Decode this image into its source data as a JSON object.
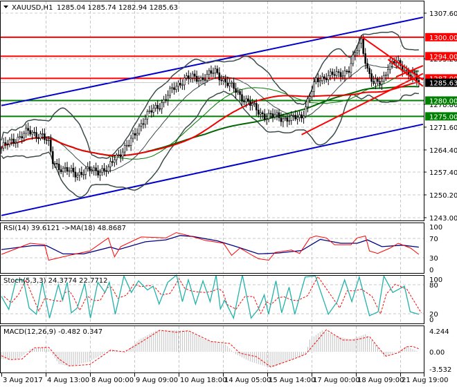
{
  "header": {
    "symbol": "XAUUSD,H1",
    "ohlc": "1285.04 1285.74 1282.94 1285.63"
  },
  "colors": {
    "level_red": "#ff0000",
    "level_green": "#008000",
    "channel": "#0000cc",
    "bands": "#3a4a4a",
    "ma_fast": "#007700",
    "ma_slow": "#ee0000",
    "ma_long": "#006400",
    "rsi": "#ff0000",
    "rsi_ma": "#000080",
    "stoch_main": "#20b2aa",
    "stoch_signal": "#ff0000",
    "macd_hist": "#c0c0c0",
    "macd_signal": "#ff0000"
  },
  "price_axis": {
    "ticks": [
      "1307.60",
      "1293.20",
      "1278.80",
      "1271.60",
      "1264.40",
      "1257.40",
      "1250.20",
      "1243.00"
    ],
    "levels": [
      {
        "value": 1300.0,
        "label": "1300.00",
        "color": "#ff0000"
      },
      {
        "value": 1294.0,
        "label": "1294.00",
        "color": "#ff0000"
      },
      {
        "value": 1287.0,
        "label": "1287.00",
        "color": "#ff0000"
      },
      {
        "value": 1280.0,
        "label": "1280.00",
        "color": "#008000"
      },
      {
        "value": 1275.0,
        "label": "1275.00",
        "color": "#008000"
      }
    ],
    "current": {
      "value": 1285.63,
      "label": "1285.63"
    }
  },
  "chart_data": {
    "type": "line",
    "title": "XAUUSD,H1",
    "price_path": [
      [
        0,
        1265
      ],
      [
        7,
        1268
      ],
      [
        13,
        1270
      ],
      [
        20,
        1269
      ],
      [
        23,
        1266
      ],
      [
        25,
        1261
      ],
      [
        30,
        1258
      ],
      [
        37,
        1257
      ],
      [
        44,
        1258
      ],
      [
        52,
        1258
      ],
      [
        55,
        1262
      ],
      [
        62,
        1266
      ],
      [
        67,
        1272
      ],
      [
        72,
        1276
      ],
      [
        79,
        1280
      ],
      [
        84,
        1284
      ],
      [
        89,
        1287
      ],
      [
        97,
        1287
      ],
      [
        104,
        1289
      ],
      [
        109,
        1286
      ],
      [
        114,
        1283
      ],
      [
        119,
        1280
      ],
      [
        124,
        1277
      ],
      [
        129,
        1275
      ],
      [
        134,
        1275
      ],
      [
        141,
        1274
      ],
      [
        146,
        1275
      ],
      [
        149,
        1280
      ],
      [
        153,
        1286
      ],
      [
        158,
        1288
      ],
      [
        164,
        1288
      ],
      [
        169,
        1290
      ],
      [
        173,
        1296
      ],
      [
        175,
        1299
      ],
      [
        178,
        1290
      ],
      [
        181,
        1285
      ],
      [
        185,
        1286
      ],
      [
        188,
        1291
      ],
      [
        191,
        1292
      ],
      [
        196,
        1290
      ],
      [
        200,
        1288
      ],
      [
        203,
        1285.6
      ]
    ],
    "channel_upper": [
      [
        0,
        1278.4
      ],
      [
        205,
        1306.3
      ]
    ],
    "channel_lower": [
      [
        0,
        1243.7
      ],
      [
        205,
        1272.5
      ]
    ],
    "trend_lines": [
      [
        [
          175,
          1300.2
        ],
        [
          205,
          1286.5
        ]
      ],
      [
        [
          146,
          1269.2
        ],
        [
          205,
          1288.5
        ]
      ],
      [
        [
          188,
          1293
        ],
        [
          205,
          1284.5
        ]
      ],
      [
        [
          192,
          1287.5
        ],
        [
          205,
          1291
        ]
      ]
    ],
    "time_labels": [
      "3 Aug 2017",
      "4 Aug 13:00",
      "8 Aug 00:00",
      "9 Aug 09:00",
      "10 Aug 18:00",
      "14 Aug 05:00",
      "15 Aug 14:00",
      "17 Aug 00:00",
      "18 Aug 09:00",
      "21 Aug 19:00"
    ],
    "ylim": [
      1243.0,
      1307.6
    ]
  },
  "rsi": {
    "label": "RSI(14) 39.6121  ->MA(18) 48.8687",
    "ticks": [
      "100",
      "70",
      "30",
      "0"
    ],
    "values": [
      [
        0,
        37
      ],
      [
        14,
        60
      ],
      [
        21,
        57
      ],
      [
        23,
        25
      ],
      [
        33,
        35
      ],
      [
        43,
        44
      ],
      [
        52,
        71
      ],
      [
        55,
        32
      ],
      [
        58,
        53
      ],
      [
        68,
        73
      ],
      [
        80,
        71
      ],
      [
        85,
        82
      ],
      [
        91,
        76
      ],
      [
        99,
        66
      ],
      [
        108,
        60
      ],
      [
        112,
        35
      ],
      [
        116,
        50
      ],
      [
        122,
        35
      ],
      [
        125,
        28
      ],
      [
        130,
        25
      ],
      [
        133,
        41
      ],
      [
        141,
        46
      ],
      [
        145,
        39
      ],
      [
        150,
        71
      ],
      [
        153,
        75
      ],
      [
        158,
        71
      ],
      [
        162,
        57
      ],
      [
        170,
        57
      ],
      [
        173,
        71
      ],
      [
        177,
        75
      ],
      [
        179,
        44
      ],
      [
        183,
        39
      ],
      [
        189,
        50
      ],
      [
        193,
        60
      ],
      [
        199,
        50
      ],
      [
        203,
        37
      ]
    ],
    "ma": [
      [
        0,
        47
      ],
      [
        15,
        55
      ],
      [
        22,
        55
      ],
      [
        30,
        38
      ],
      [
        40,
        38
      ],
      [
        53,
        52
      ],
      [
        57,
        47
      ],
      [
        70,
        63
      ],
      [
        80,
        67
      ],
      [
        87,
        76
      ],
      [
        93,
        74
      ],
      [
        105,
        65
      ],
      [
        115,
        52
      ],
      [
        125,
        38
      ],
      [
        135,
        40
      ],
      [
        146,
        45
      ],
      [
        155,
        68
      ],
      [
        165,
        60
      ],
      [
        173,
        60
      ],
      [
        178,
        67
      ],
      [
        185,
        53
      ],
      [
        195,
        56
      ],
      [
        203,
        52
      ]
    ]
  },
  "stoch": {
    "label": "Stoch(5,3,3) 24.3774 22.7712",
    "ticks": [
      "100",
      "80",
      "20",
      "0"
    ],
    "main": [
      [
        0,
        56
      ],
      [
        3.6,
        29
      ],
      [
        7.1,
        90
      ],
      [
        10.7,
        90
      ],
      [
        13.5,
        32
      ],
      [
        17,
        19
      ],
      [
        19.9,
        85
      ],
      [
        23.4,
        11
      ],
      [
        27.7,
        80
      ],
      [
        29.8,
        48
      ],
      [
        32,
        85
      ],
      [
        34,
        22
      ],
      [
        36.9,
        32
      ],
      [
        40.5,
        83
      ],
      [
        43.3,
        11
      ],
      [
        46.9,
        85
      ],
      [
        50.4,
        64
      ],
      [
        52.5,
        85
      ],
      [
        55.4,
        19
      ],
      [
        59.6,
        98
      ],
      [
        63.2,
        64
      ],
      [
        66.7,
        88
      ],
      [
        71,
        69
      ],
      [
        73.8,
        77
      ],
      [
        76.7,
        40
      ],
      [
        80.9,
        85
      ],
      [
        85.2,
        100
      ],
      [
        88,
        45
      ],
      [
        90.9,
        90
      ],
      [
        94.4,
        40
      ],
      [
        98,
        88
      ],
      [
        101.5,
        45
      ],
      [
        104.4,
        100
      ],
      [
        106.5,
        30
      ],
      [
        108.6,
        48
      ],
      [
        112.9,
        11
      ],
      [
        117.2,
        100
      ],
      [
        121.4,
        11
      ],
      [
        125,
        30
      ],
      [
        127.8,
        59
      ],
      [
        129.9,
        19
      ],
      [
        133.5,
        88
      ],
      [
        136.3,
        22
      ],
      [
        139.9,
        75
      ],
      [
        142.7,
        19
      ],
      [
        147.7,
        96
      ],
      [
        152.7,
        98
      ],
      [
        159,
        19
      ],
      [
        163.3,
        45
      ],
      [
        166.9,
        90
      ],
      [
        170.4,
        45
      ],
      [
        174,
        96
      ],
      [
        179,
        16
      ],
      [
        183.2,
        24
      ],
      [
        186,
        98
      ],
      [
        190.3,
        64
      ],
      [
        196,
        77
      ],
      [
        198.8,
        24
      ],
      [
        203,
        19
      ]
    ]
  },
  "macd": {
    "label": "MACD(12,26,9) -0.482 0.347",
    "ticks": [
      "4.244",
      "0.00",
      "-3.532"
    ],
    "hist": [
      [
        0,
        -1.5
      ],
      [
        8.5,
        -1.5
      ],
      [
        14,
        0.5
      ],
      [
        21,
        1.0
      ],
      [
        23,
        0.5
      ],
      [
        28,
        -2.5
      ],
      [
        33,
        -3.0
      ],
      [
        43,
        -2
      ],
      [
        53,
        0.5
      ],
      [
        60,
        -0.2
      ],
      [
        67,
        2.5
      ],
      [
        75,
        4.3
      ],
      [
        85,
        4.4
      ],
      [
        91,
        4.3
      ],
      [
        99,
        2.5
      ],
      [
        109,
        1.5
      ],
      [
        114,
        -0.5
      ],
      [
        121,
        -2
      ],
      [
        131,
        -3.3
      ],
      [
        142,
        -1.5
      ],
      [
        148,
        -0.5
      ],
      [
        150,
        2.5
      ],
      [
        156,
        4.4
      ],
      [
        165,
        3
      ],
      [
        170,
        2.5
      ],
      [
        177,
        3.6
      ],
      [
        183,
        1
      ],
      [
        186,
        -1
      ],
      [
        193,
        0.2
      ],
      [
        197,
        1.1
      ],
      [
        203,
        0
      ]
    ],
    "signal": [
      [
        0,
        -0.8
      ],
      [
        4,
        -1.6
      ],
      [
        10,
        -1.5
      ],
      [
        16,
        0.8
      ],
      [
        23,
        0.9
      ],
      [
        28,
        -1.5
      ],
      [
        33,
        -2.9
      ],
      [
        43,
        -2.6
      ],
      [
        53,
        0.3
      ],
      [
        60,
        0
      ],
      [
        68,
        2
      ],
      [
        77,
        4.4
      ],
      [
        85,
        4
      ],
      [
        91,
        4.3
      ],
      [
        102,
        2.1
      ],
      [
        111,
        1.7
      ],
      [
        116,
        -0.3
      ],
      [
        124,
        -1
      ],
      [
        131,
        -3.1
      ],
      [
        142,
        -1.5
      ],
      [
        148,
        -0.5
      ],
      [
        152,
        1.5
      ],
      [
        158,
        4.5
      ],
      [
        166,
        2.4
      ],
      [
        172,
        2.4
      ],
      [
        179,
        3.1
      ],
      [
        185,
        0
      ],
      [
        187,
        -0.9
      ],
      [
        193,
        -0.2
      ],
      [
        197,
        1
      ],
      [
        200,
        1.1
      ],
      [
        203,
        0.6
      ]
    ]
  }
}
